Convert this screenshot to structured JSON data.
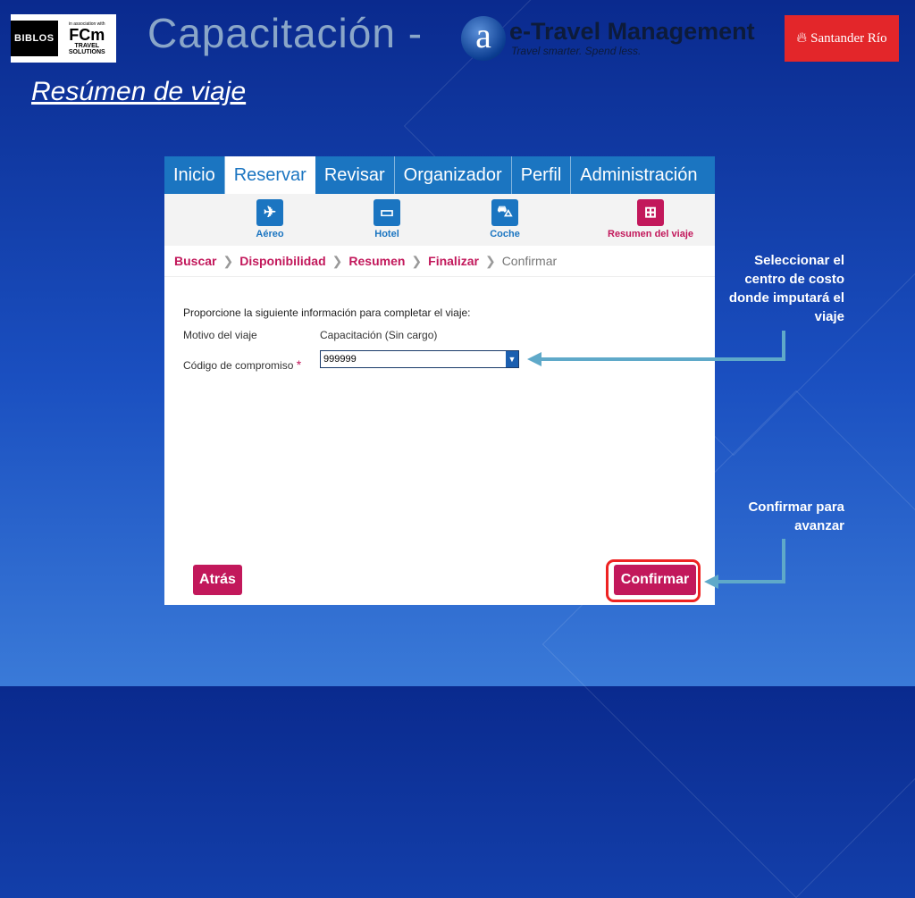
{
  "header": {
    "logos": {
      "biblos": "BIBLOS",
      "fct_association": "in association with",
      "fct_brand": "FCm",
      "fct_sub": "TRAVEL SOLUTIONS"
    },
    "title": "Capacitación -",
    "etm": {
      "circle_letter": "a",
      "name": "e-Travel Management",
      "tagline": "Travel smarter. Spend less."
    },
    "santander": {
      "icon": "flame-icon",
      "label": "Santander Río",
      "color": "#e3262a"
    }
  },
  "subtitle": "Resúmen de viaje",
  "app": {
    "tabs": [
      {
        "label": "Inicio",
        "active": false
      },
      {
        "label": "Reservar",
        "active": true
      },
      {
        "label": "Revisar",
        "active": false
      },
      {
        "label": "Organizador",
        "active": false
      },
      {
        "label": "Perfil",
        "active": false
      },
      {
        "label": "Administración",
        "active": false
      }
    ],
    "subnav": [
      {
        "label": "Aéreo",
        "icon": "airplane-icon"
      },
      {
        "label": "Hotel",
        "icon": "bed-icon"
      },
      {
        "label": "Coche",
        "icon": "car-icon"
      },
      {
        "label": "Resumen del viaje",
        "icon": "basket-icon",
        "active": true
      }
    ],
    "breadcrumb": [
      "Buscar",
      "Disponibilidad",
      "Resumen",
      "Finalizar",
      "Confirmar"
    ],
    "form": {
      "intro": "Proporcione la siguiente información para completar el viaje:",
      "motivo_label": "Motivo del viaje",
      "motivo_value": "Capacitación (Sin cargo)",
      "codigo_label": "Código de compromiso",
      "codigo_value": "999999"
    },
    "buttons": {
      "back": "Atrás",
      "confirm": "Confirmar"
    },
    "accent_color": "#1b75c1",
    "highlight_color": "#c2185b"
  },
  "notes": {
    "select_cost_center": "Seleccionar el centro de costo donde imputará el viaje",
    "confirm": "Confirmar para avanzar"
  }
}
